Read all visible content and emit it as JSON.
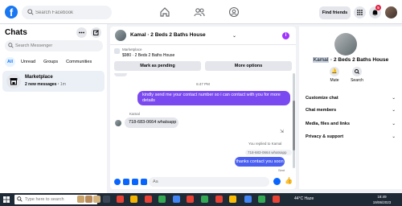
{
  "topbar": {
    "logo": "f",
    "search_placeholder": "Search Facebook",
    "find_friends": "Find friends",
    "notification_count": "5"
  },
  "left": {
    "title": "Chats",
    "search_placeholder": "Search Messenger",
    "filters": [
      "All",
      "Unread",
      "Groups",
      "Communities"
    ],
    "conversation": {
      "name": "Marketplace",
      "preview": "2 new messages",
      "time": "1m"
    }
  },
  "chat": {
    "title": "Kamal · 2 Beds 2 Baths House",
    "info_icon": "i",
    "listing_label": "Marketplace",
    "listing_price": "$980 · 2 Beds 2 Baths House",
    "mark_pending": "Mark as pending",
    "more_options": "More options",
    "time_divider": "6:47 PM",
    "msg_out": "kindly send me your contact number so i can contact with you for more details",
    "sender_name": "Kamal",
    "msg_in": "718-683-0664 whatsapp",
    "replied_label": "You replied to Kamal",
    "quoted": "718-683-0664 whatsapp",
    "msg_out2": "thanks contact you soon",
    "sent_status": "Sent",
    "composer_placeholder": "Aa"
  },
  "right": {
    "title_highlight": "Kamal",
    "title_rest": " · 2 Beds 2 Baths House",
    "mute": "Mute",
    "search": "Search",
    "rows": [
      "Customize chat",
      "Chat members",
      "Media, files and links",
      "Privacy & support"
    ]
  },
  "taskbar": {
    "search_placeholder": "Type here to search",
    "weather": "44°C  Haze",
    "time": "18:49",
    "date": "19/06/2023"
  },
  "colors": {
    "brand": "#1877f2",
    "bubble_out": "#7b49f0",
    "bubble_out2": "#4a5ff0",
    "notification": "#e41e3f"
  }
}
